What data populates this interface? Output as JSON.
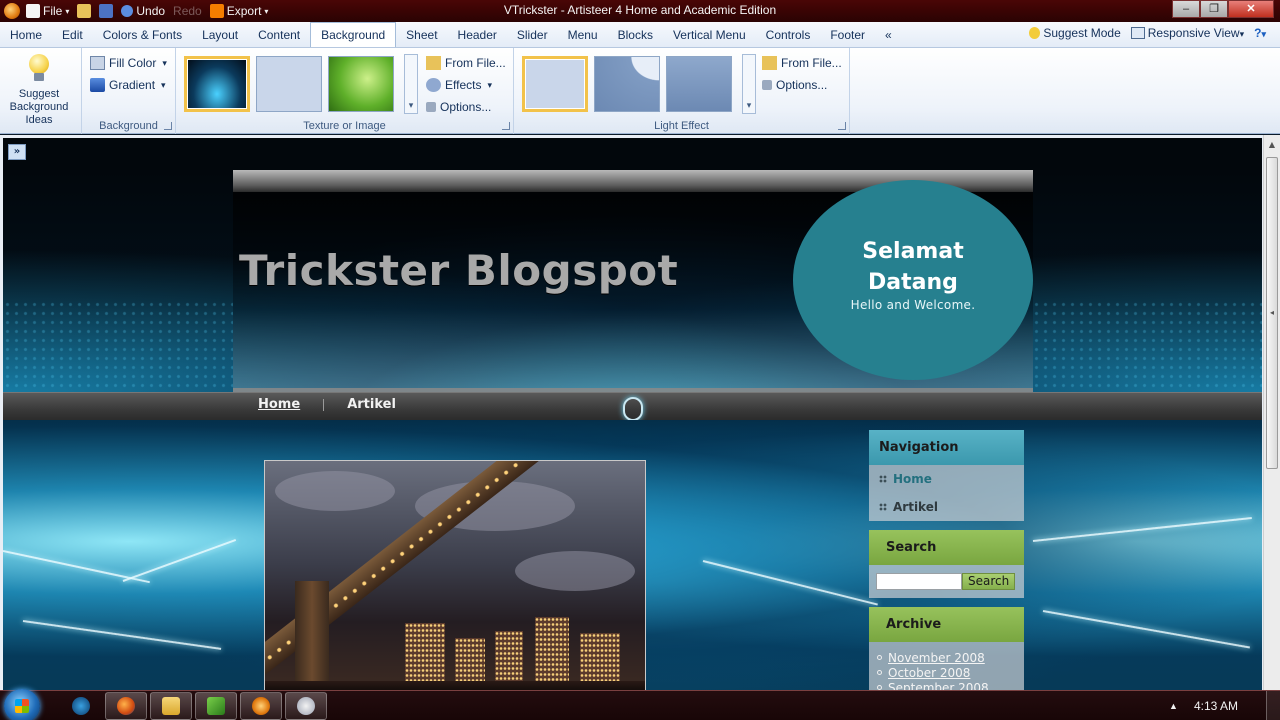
{
  "window": {
    "title": "VTrickster - Artisteer 4 Home and Academic Edition",
    "qat": {
      "file": "File",
      "undo": "Undo",
      "redo": "Redo",
      "export": "Export"
    },
    "buttons": {
      "minimize": "–",
      "maximize": "❐",
      "close": "✕"
    }
  },
  "ribbon": {
    "tabs": [
      "Home",
      "Edit",
      "Colors & Fonts",
      "Layout",
      "Content",
      "Background",
      "Sheet",
      "Header",
      "Slider",
      "Menu",
      "Blocks",
      "Vertical Menu",
      "Controls",
      "Footer",
      "«"
    ],
    "active_tab": "Background",
    "suggest_mode": "Suggest Mode",
    "responsive_view": "Responsive View",
    "help": "?",
    "groups": {
      "suggest": {
        "label": "Suggest Background Ideas"
      },
      "background": {
        "label": "Background",
        "fill_color": "Fill Color",
        "gradient": "Gradient"
      },
      "texture": {
        "label": "Texture or Image",
        "from_file": "From File...",
        "effects": "Effects",
        "options": "Options..."
      },
      "light": {
        "label": "Light Effect",
        "from_file": "From File...",
        "options": "Options..."
      }
    }
  },
  "site": {
    "expander": "»",
    "title": "Trickster Blogspot",
    "welcome_title": "Selamat Datang",
    "welcome_sub": "Hello and Welcome.",
    "nav": [
      "Home",
      "Artikel"
    ],
    "sidebar": {
      "navigation": {
        "heading": "Navigation",
        "items": [
          "Home",
          "Artikel"
        ]
      },
      "search": {
        "heading": "Search",
        "button": "Search",
        "value": ""
      },
      "archive": {
        "heading": "Archive",
        "items": [
          "November 2008",
          "October 2008",
          "September 2008"
        ]
      }
    }
  },
  "taskbar": {
    "clock": "4:13 AM",
    "tray_arrow": "▲"
  },
  "colors": {
    "accent": "#26808f",
    "ribbon_text": "#15315a",
    "nav_block": "#3b98ad",
    "green_block": "#79a640"
  }
}
